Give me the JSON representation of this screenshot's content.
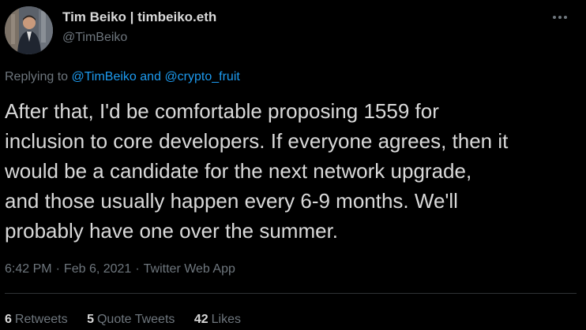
{
  "author": {
    "avatar_icon": "profile-photo",
    "display_name": "Tim Beiko | timbeiko.eth",
    "handle": "@TimBeiko"
  },
  "more_icon": "more-horizontal-icon",
  "reply_context": {
    "prefix": "Replying to",
    "mention_1": "@TimBeiko",
    "connector": "and",
    "mention_2": "@crypto_fruit"
  },
  "tweet": {
    "text": "After that, I'd be comfortable proposing 1559 for\ninclusion to core developers. If everyone agrees, then it\nwould be a candidate for the next network upgrade,\nand those usually happen every 6-9 months. We'll\nprobably have one over the summer."
  },
  "meta": {
    "time": "6:42 PM",
    "separator": "·",
    "date": "Feb 6, 2021",
    "source": "Twitter Web App"
  },
  "stats": {
    "retweets_count": "6",
    "retweets_label": "Retweets",
    "quotes_count": "5",
    "quotes_label": "Quote Tweets",
    "likes_count": "42",
    "likes_label": "Likes"
  },
  "colors": {
    "background": "#000000",
    "text": "#d9d9d9",
    "secondary": "#6e767d",
    "link": "#1d9bf0",
    "divider": "#2f3336"
  }
}
